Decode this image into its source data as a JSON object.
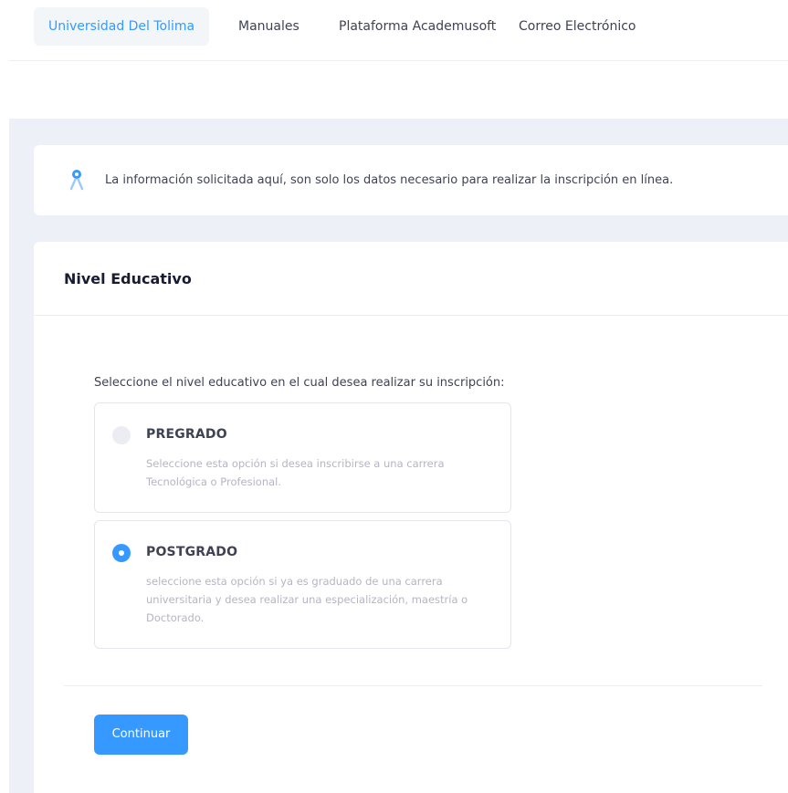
{
  "nav": {
    "items": [
      {
        "label": "Universidad Del Tolima",
        "active": true
      },
      {
        "label": "Manuales",
        "active": false
      },
      {
        "label": "Plataforma Academusoft",
        "active": false
      },
      {
        "label": "Correo Electrónico",
        "active": false
      }
    ]
  },
  "alert": {
    "icon": "person-pin-icon",
    "text": "La información solicitada aquí, son solo los datos necesario para realizar la inscripción en línea."
  },
  "form": {
    "title": "Nivel Educativo",
    "prompt": "Seleccione el nivel educativo en el cual desea realizar su inscripción:",
    "options": [
      {
        "label": "PREGRADO",
        "description": "Seleccione esta opción si desea inscribirse a una carrera Tecnológica o Profesional.",
        "selected": false
      },
      {
        "label": "POSTGRADO",
        "description": "seleccione esta opción si ya es graduado de una carrera universitaria y desea realizar una especialización, maestría o Doctorado.",
        "selected": true
      }
    ],
    "submit_label": "Continuar"
  },
  "colors": {
    "primary": "#3699ff",
    "background": "#eef0f8",
    "muted_text": "#b5b5c3"
  }
}
